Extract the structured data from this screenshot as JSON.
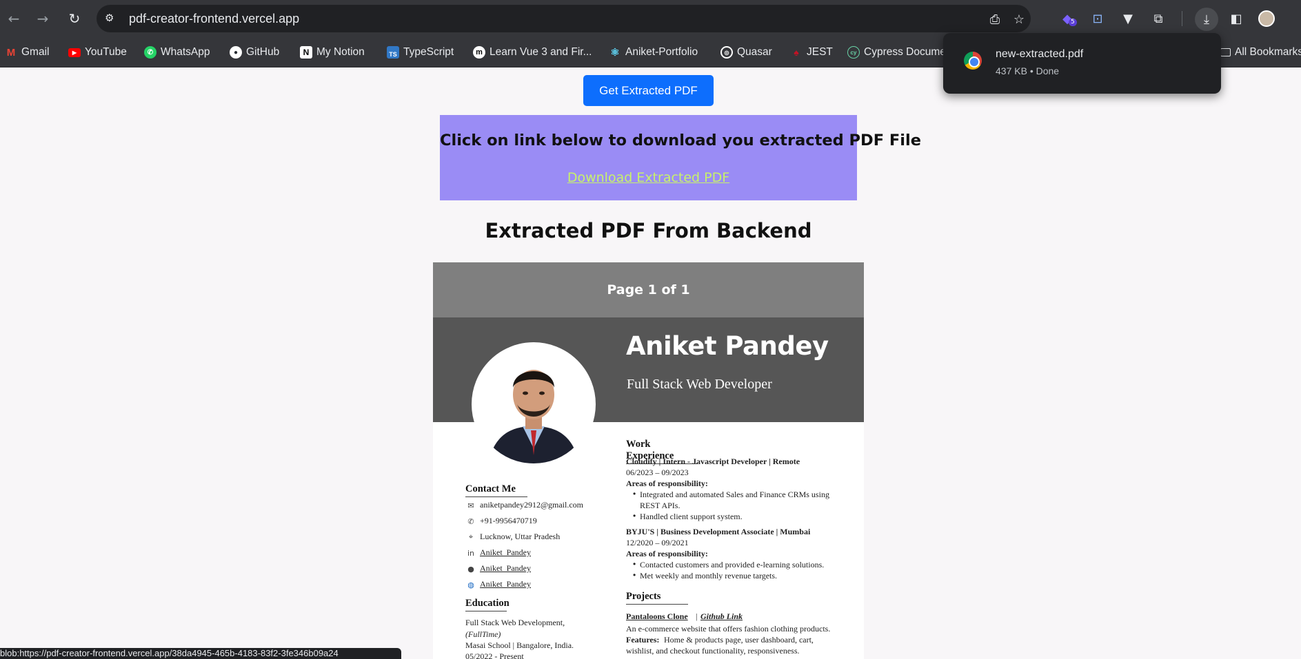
{
  "browser": {
    "url": "pdf-creator-frontend.vercel.app",
    "extension_badge": "5",
    "bookmarks": [
      {
        "label": "Gmail",
        "icon": "gmail-icon",
        "color": "#ea4335"
      },
      {
        "label": "YouTube",
        "icon": "youtube-icon",
        "color": "#ff0000"
      },
      {
        "label": "WhatsApp",
        "icon": "whatsapp-icon",
        "color": "#25d366"
      },
      {
        "label": "GitHub",
        "icon": "github-icon",
        "color": "#ffffff"
      },
      {
        "label": "My Notion",
        "icon": "notion-icon",
        "color": "#ffffff"
      },
      {
        "label": "TypeScript",
        "icon": "typescript-icon",
        "color": "#3178c6"
      },
      {
        "label": "Learn Vue 3 and Fir...",
        "icon": "vue-course-icon",
        "color": "#ffffff"
      },
      {
        "label": "Aniket-Portfolio",
        "icon": "react-icon",
        "color": "#61dafb"
      },
      {
        "label": "Quasar",
        "icon": "quasar-icon",
        "color": "#1976d2"
      },
      {
        "label": "JEST",
        "icon": "jest-icon",
        "color": "#c21325"
      },
      {
        "label": "Cypress Docume",
        "icon": "cypress-icon",
        "color": "#69d3a7"
      }
    ],
    "all_bookmarks": "All Bookmarks",
    "download_popup": {
      "filename": "new-extracted.pdf",
      "meta": "437 KB • Done"
    },
    "status_url": "blob:https://pdf-creator-frontend.vercel.app/38da4945-465b-4183-83f2-3fe346b09a24"
  },
  "page": {
    "button_label": "Get Extracted PDF",
    "download_heading": "Click on link below to download you extracted PDF File",
    "download_link": "Download Extracted PDF",
    "section_title": "Extracted PDF From Backend",
    "accent_color": "#0d6efd",
    "box_color": "#9a8cf5"
  },
  "pdf": {
    "page_indicator": "Page 1 of 1",
    "name": "Aniket Pandey",
    "role": "Full Stack Web Developer",
    "contact_title": "Contact Me",
    "contacts": [
      {
        "icon": "mail-icon",
        "text": "aniketpandey2912@gmail.com",
        "underline": false
      },
      {
        "icon": "phone-icon",
        "text": "+91-9956470719",
        "underline": false
      },
      {
        "icon": "location-icon",
        "text": "Lucknow, Uttar Pradesh",
        "underline": false
      },
      {
        "icon": "linkedin-icon",
        "text": "Aniket_Pandey",
        "underline": true
      },
      {
        "icon": "github-icon",
        "text": "Aniket_Pandey",
        "underline": true
      },
      {
        "icon": "globe-icon",
        "text": "Aniket_Pandey",
        "underline": true
      }
    ],
    "education_title": "Education",
    "education": {
      "course": "Full Stack Web Development,",
      "mode": "(FullTime)",
      "school": "Masai School | Bangalore, India.",
      "dates": "05/2022 - Present"
    },
    "work_title": "Work Experience",
    "jobs": [
      {
        "title": "Cloudify | Intern - Javascript Developer | Remote",
        "dates": "06/2023 – 09/2023",
        "areas_label": "Areas of responsibility:",
        "bullets": [
          "Integrated and automated Sales and Finance CRMs using",
          "REST APIs.",
          "Handled client support system."
        ]
      },
      {
        "title": "BYJU'S | Business Development Associate | Mumbai",
        "dates": "12/2020 – 09/2021",
        "areas_label": "Areas of responsibility:",
        "bullets": [
          "Contacted customers and provided e-learning solutions.",
          "Met weekly and monthly revenue targets."
        ]
      }
    ],
    "projects_title": "Projects",
    "project": {
      "name": "Pantaloons Clone",
      "separator": "|",
      "link": "Github Link",
      "desc": "An e-commerce website that offers fashion clothing products.",
      "features_label": "Features:",
      "features_1": "Home & products page, user dashboard, cart,",
      "features_2": "wishlist, and checkout functionality, responsiveness."
    }
  }
}
